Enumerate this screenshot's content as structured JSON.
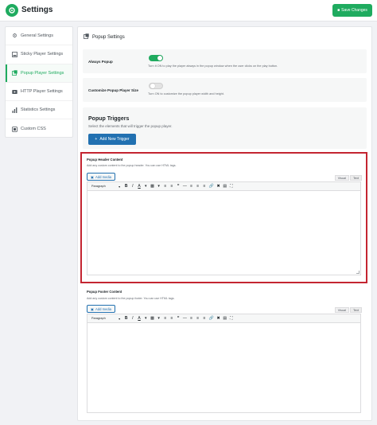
{
  "app": {
    "title": "Settings",
    "save_label": "Save Changes"
  },
  "sidebar": {
    "items": [
      {
        "label": "General Settings",
        "icon": "gear-icon"
      },
      {
        "label": "Sticky Player Settings",
        "icon": "sticky-player-icon"
      },
      {
        "label": "Popup Player Settings",
        "icon": "popup-player-icon",
        "active": true
      },
      {
        "label": "HTTP Player Settings",
        "icon": "http-player-icon"
      },
      {
        "label": "Statistics Settings",
        "icon": "statistics-icon"
      },
      {
        "label": "Custom CSS",
        "icon": "custom-css-icon"
      }
    ]
  },
  "main": {
    "section_title": "Popup Settings",
    "always_popup": {
      "label": "Always Popup",
      "enabled": true,
      "description": "Turn it ON to play the player always in the popup window when the user clicks on the play button."
    },
    "customize_size": {
      "label": "Customize Popup Player Size",
      "enabled": false,
      "description": "Turn ON to customize the popup player width and height."
    },
    "triggers": {
      "title": "Popup Triggers",
      "subtitle": "Select the elements that will trigger the popup player.",
      "add_button": "Add New Trigger"
    },
    "header_content": {
      "label": "Popup Header Content",
      "description": "Add any custom content to the popup header. You can use HTML tags.",
      "add_media": "Add media",
      "tab_visual": "Visual",
      "tab_text": "Text",
      "format": "Paragraph"
    },
    "footer_content": {
      "label": "Popup Footer Content",
      "description": "Add any custom content to the popup footer. You can use HTML tags.",
      "add_media": "Add media",
      "tab_visual": "Visual",
      "tab_text": "Text",
      "format": "Paragraph"
    }
  },
  "colors": {
    "accent": "#1fab5f",
    "primary_button": "#2271b1",
    "highlight": "#c42531"
  }
}
